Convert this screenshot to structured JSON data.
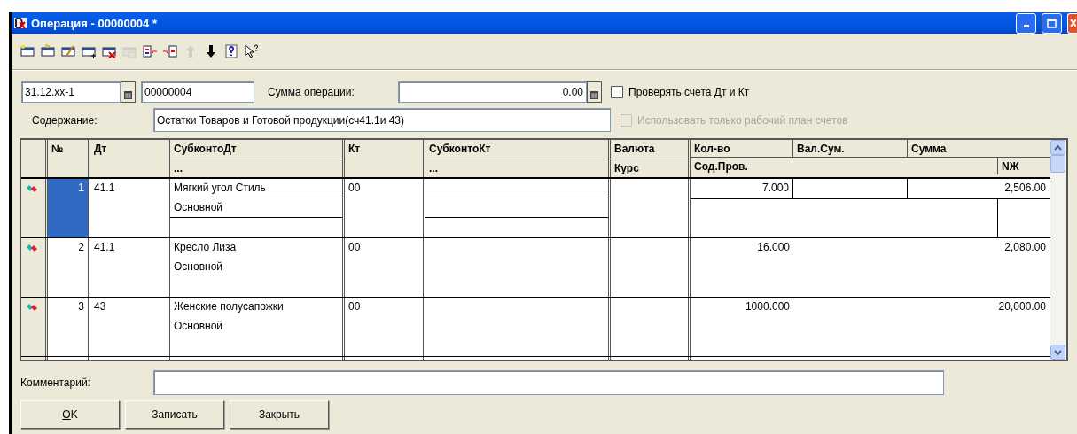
{
  "window": {
    "title": "Операция - 00000004 *"
  },
  "toolbar": [
    {
      "kind": "new",
      "disabled": false
    },
    {
      "kind": "new-group",
      "disabled": false
    },
    {
      "kind": "edit",
      "disabled": false
    },
    {
      "kind": "add",
      "disabled": false
    },
    {
      "kind": "delete",
      "disabled": false
    },
    {
      "kind": "copy",
      "disabled": true
    },
    {
      "kind": "move-left",
      "disabled": false
    },
    {
      "kind": "move-right",
      "disabled": false
    },
    {
      "kind": "up",
      "disabled": true
    },
    {
      "kind": "down",
      "disabled": false
    },
    {
      "kind": "help",
      "disabled": false
    },
    {
      "kind": "whats-this",
      "disabled": false
    }
  ],
  "form": {
    "date": "31.12.xx-1",
    "number": "00000004",
    "sum_label": "Сумма операции:",
    "sum": "0.00",
    "checks": [
      {
        "label": "Проверять счета Дт и Кт",
        "checked": false,
        "disabled": false
      },
      {
        "label": "Использовать только рабочий план счетов",
        "checked": false,
        "disabled": true
      }
    ],
    "content_label": "Содержание:",
    "content": "Остатки Товаров и Готовой продукции(сч41.1и 43)"
  },
  "table": {
    "header_top": [
      "№",
      "Дт",
      "СубконтоДт",
      "Кт",
      "СубконтоКт",
      "Валюта",
      "Кол-во",
      "Вал.Сум.",
      "Сумма"
    ],
    "header_bottom": {
      "subconto_dt": "...",
      "subconto_kt": "...",
      "rate": "Курс",
      "content": "Сод.Пров.",
      "nj": "NЖ"
    },
    "rows": [
      {
        "number": "1",
        "dt": "41.1",
        "subconto_dt": [
          "Мягкий угол Стиль",
          "Основной"
        ],
        "kt": "00",
        "qty": "7.000",
        "sum": "2,506.00",
        "selected": true
      },
      {
        "number": "2",
        "dt": "41.1",
        "subconto_dt": [
          "Кресло Лиза",
          "Основной"
        ],
        "kt": "00",
        "qty": "16.000",
        "sum": "2,080.00",
        "selected": false
      },
      {
        "number": "3",
        "dt": "43",
        "subconto_dt": [
          "Женские полусапожки",
          "Основной"
        ],
        "kt": "00",
        "qty": "1000.000",
        "sum": "20,000.00",
        "selected": false
      }
    ]
  },
  "comment_label": "Комментарий:",
  "buttons": [
    {
      "label": "OK",
      "accelerator": true
    },
    {
      "label": "Записать",
      "accelerator": false
    },
    {
      "label": "Закрыть",
      "accelerator": false
    }
  ]
}
